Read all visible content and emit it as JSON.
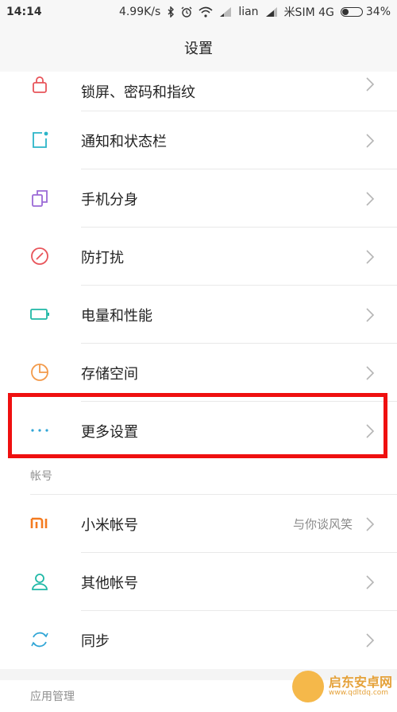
{
  "status": {
    "time": "14:14",
    "speed": "4.99K/s",
    "carrier1": "lian",
    "carrier2": "米SIM 4G",
    "battery": "34%",
    "battery_level": 0.34
  },
  "header": {
    "title": "设置"
  },
  "system_items": [
    {
      "label": "锁屏、密码和指纹",
      "icon": "lock-icon",
      "color": "#e8545a"
    },
    {
      "label": "通知和状态栏",
      "icon": "notification-icon",
      "color": "#2bb5c8"
    },
    {
      "label": "手机分身",
      "icon": "dual-apps-icon",
      "color": "#9b6ad6"
    },
    {
      "label": "防打扰",
      "icon": "do-not-disturb-icon",
      "color": "#e8545a"
    },
    {
      "label": "电量和性能",
      "icon": "battery-icon",
      "color": "#1fb8a6"
    },
    {
      "label": "存储空间",
      "icon": "storage-pie-icon",
      "color": "#f39a4a"
    },
    {
      "label": "更多设置",
      "icon": "more-dots-icon",
      "color": "#2fa5d6"
    }
  ],
  "accounts_section": {
    "title": "帐号",
    "items": [
      {
        "label": "小米帐号",
        "value": "与你谈风笑",
        "icon": "mi-logo-icon",
        "color": "#f47b20"
      },
      {
        "label": "其他帐号",
        "icon": "person-icon",
        "color": "#1fb8a6"
      },
      {
        "label": "同步",
        "icon": "sync-icon",
        "color": "#2fa5d6"
      }
    ]
  },
  "apps_section": {
    "title": "应用管理"
  },
  "watermark": {
    "name": "启东安卓网",
    "url": "www.qdltdq.com"
  }
}
